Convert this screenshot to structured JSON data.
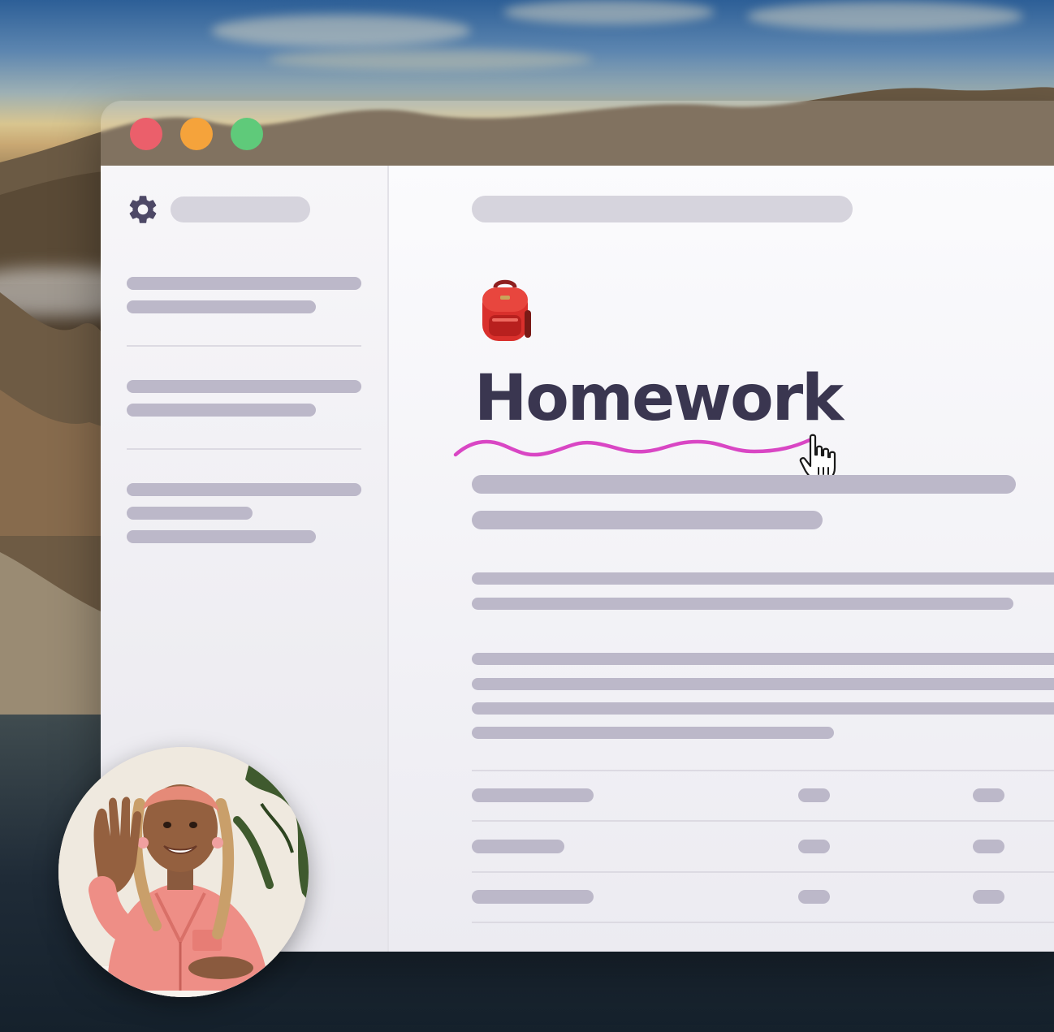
{
  "window": {
    "controls": {
      "close_color": "#eb5f6b",
      "minimize_color": "#f5a33b",
      "maximize_color": "#5fca7a"
    }
  },
  "sidebar": {
    "settings_icon": "gear-icon"
  },
  "document": {
    "icon": "backpack-icon",
    "title": "Homework",
    "underline_color": "#d946c4"
  },
  "cursor": {
    "icon": "hand-pointer-icon"
  },
  "avatar": {
    "description_icon": "video-bubble"
  }
}
